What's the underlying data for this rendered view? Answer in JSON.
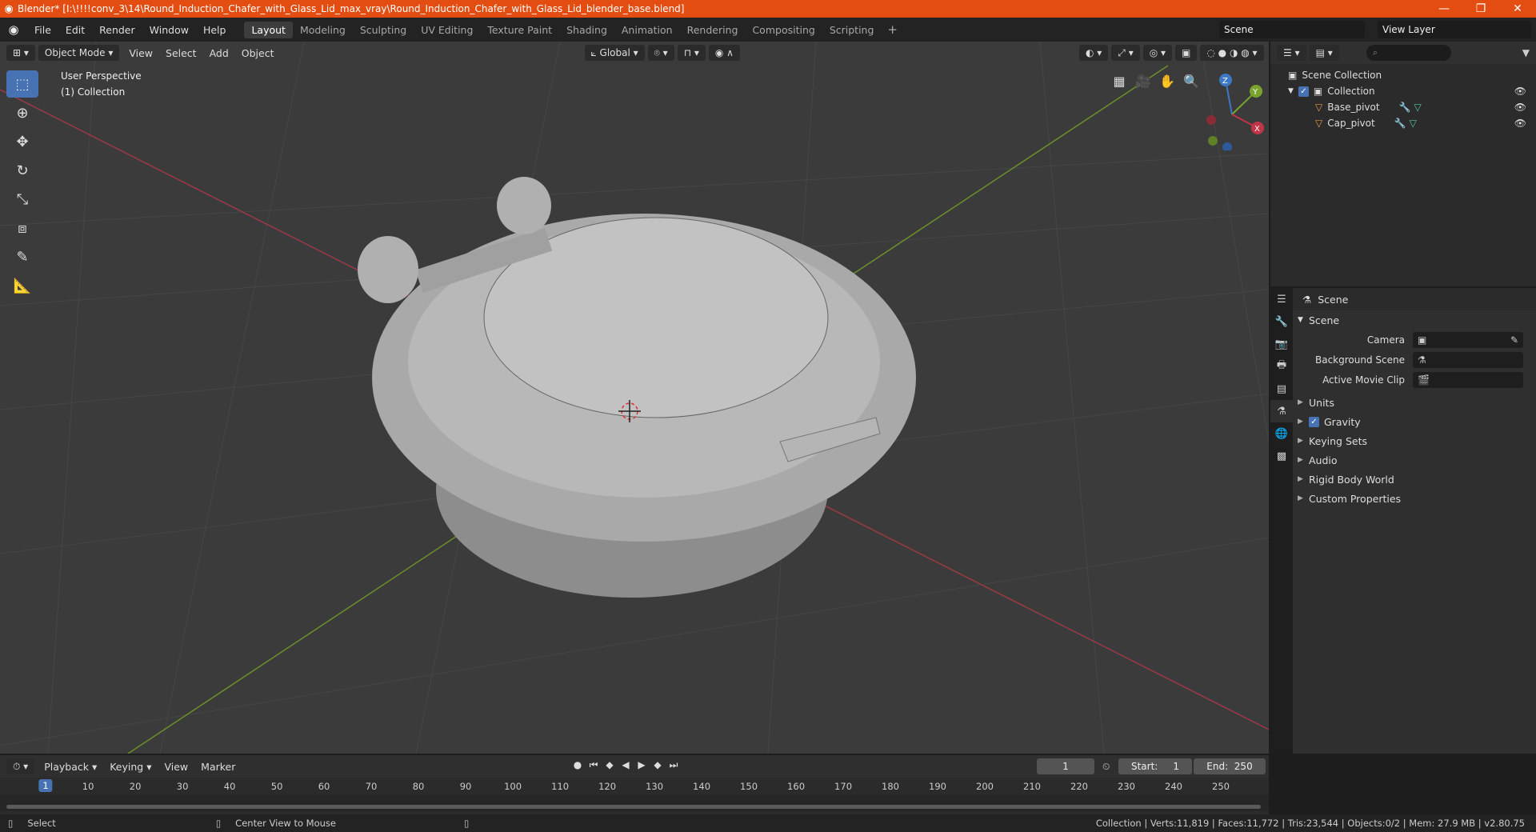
{
  "titlebar": {
    "title": "Blender* [I:\\!!!!conv_3\\14\\Round_Induction_Chafer_with_Glass_Lid_max_vray\\Round_Induction_Chafer_with_Glass_Lid_blender_base.blend]",
    "minimize": "—",
    "maximize": "❐",
    "close": "✕"
  },
  "menubar": {
    "items": [
      "File",
      "Edit",
      "Render",
      "Window",
      "Help"
    ],
    "workspaces": [
      "Layout",
      "Modeling",
      "Sculpting",
      "UV Editing",
      "Texture Paint",
      "Shading",
      "Animation",
      "Rendering",
      "Compositing",
      "Scripting"
    ],
    "add_tab": "+",
    "scene": "Scene",
    "view_layer": "View Layer"
  },
  "viewport": {
    "mode": "Object Mode",
    "menus": [
      "View",
      "Select",
      "Add",
      "Object"
    ],
    "orientation": "Global",
    "view_name": "User Perspective",
    "collection_name": "(1) Collection",
    "gizmo_axes": [
      "Z",
      "Y",
      "X"
    ],
    "colors": {
      "bg": "#3b3b3b",
      "grid": "#474747",
      "x_axis": "#9b3a45",
      "y_axis": "#6b8f2a",
      "accent": "#4772b3"
    }
  },
  "outliner": {
    "root": "Scene Collection",
    "collection": "Collection",
    "objects": [
      "Base_pivot",
      "Cap_pivot"
    ]
  },
  "properties": {
    "context": "Scene",
    "panel": "Scene",
    "rows": [
      {
        "label": "Camera",
        "value": ""
      },
      {
        "label": "Background Scene",
        "value": ""
      },
      {
        "label": "Active Movie Clip",
        "value": ""
      }
    ],
    "subpanels": [
      "Units",
      "Gravity",
      "Keying Sets",
      "Audio",
      "Rigid Body World",
      "Custom Properties"
    ]
  },
  "timeline": {
    "menus": [
      "Playback",
      "Keying",
      "View",
      "Marker"
    ],
    "current_frame": "1",
    "start_label": "Start:",
    "start": "1",
    "end_label": "End:",
    "end": "250",
    "ticks": [
      "1",
      "10",
      "20",
      "30",
      "40",
      "50",
      "60",
      "70",
      "80",
      "90",
      "100",
      "110",
      "120",
      "130",
      "140",
      "150",
      "160",
      "170",
      "180",
      "190",
      "200",
      "210",
      "220",
      "230",
      "240",
      "250"
    ]
  },
  "statusbar": {
    "left": "Select",
    "middle": "Center View to Mouse",
    "stats": "Collection | Verts:11,819 | Faces:11,772 | Tris:23,544 | Objects:0/2 | Mem: 27.9 MB | v2.80.75"
  }
}
